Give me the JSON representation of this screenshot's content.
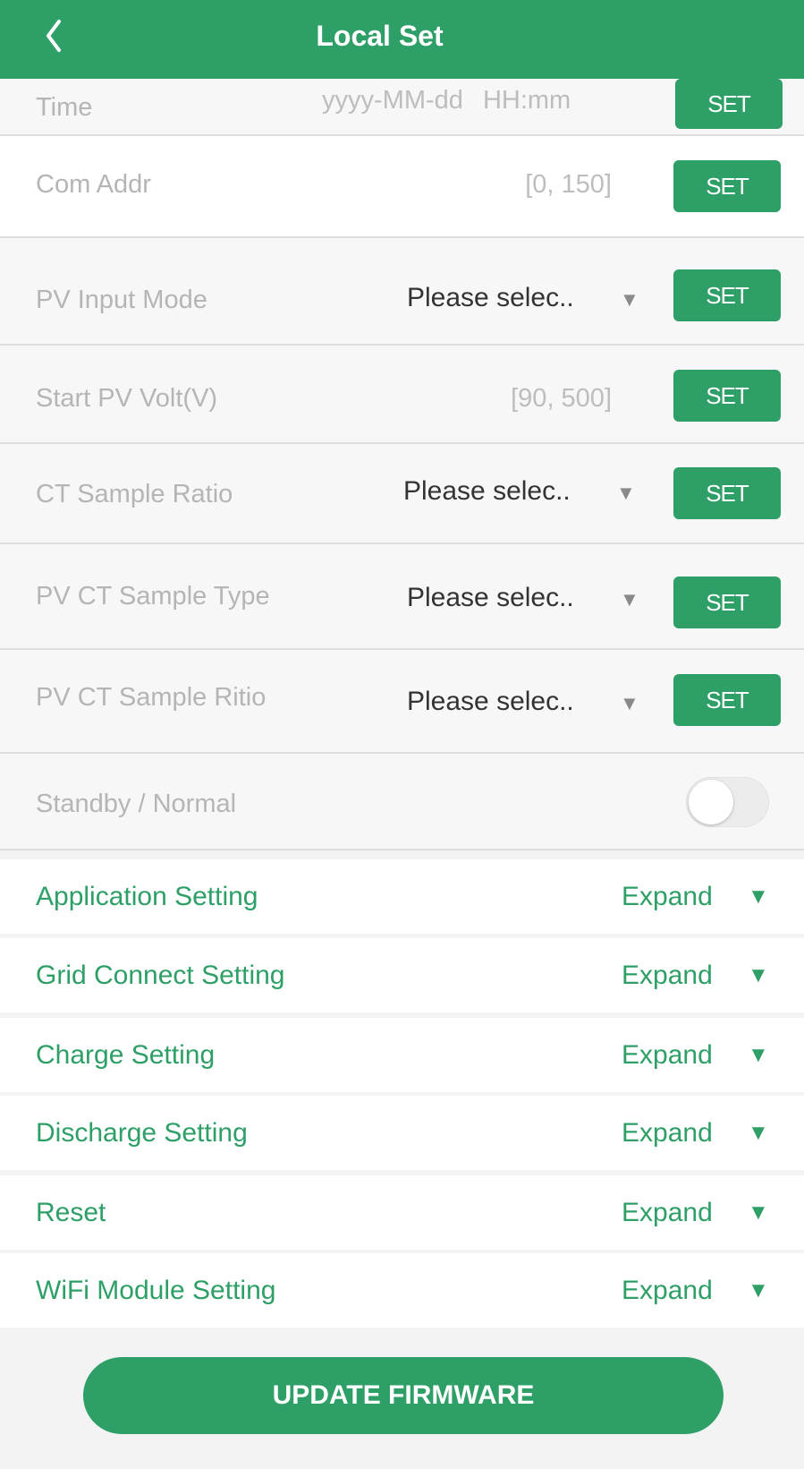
{
  "header": {
    "title": "Local Set",
    "back_icon": "chevron-left-icon"
  },
  "settings": {
    "time": {
      "label": "Time",
      "value": "yyyy-MM-dd  HH:mm",
      "button": "SET"
    },
    "com_addr": {
      "label": "Com Addr",
      "range": "[0, 150]",
      "button": "SET"
    },
    "pv_input_mode": {
      "label": "PV Input Mode",
      "selected": "Please selec..",
      "button": "SET"
    },
    "start_pv_volt": {
      "label": "Start PV Volt(V)",
      "range": "[90, 500]",
      "button": "SET"
    },
    "ct_sample_ratio": {
      "label": "CT Sample Ratio",
      "selected": "Please selec..",
      "button": "SET"
    },
    "pv_ct_sample_type": {
      "label": "PV CT Sample Type",
      "selected": "Please selec..",
      "button": "SET"
    },
    "pv_ct_sample_ritio": {
      "label": "PV CT Sample Ritio",
      "selected": "Please selec..",
      "button": "SET"
    },
    "standby": {
      "label": "Standby / Normal",
      "on": false
    }
  },
  "select_arrow": "▼",
  "sections": [
    {
      "label": "Application Setting",
      "action": "Expand"
    },
    {
      "label": "Grid Connect Setting",
      "action": "Expand"
    },
    {
      "label": "Charge Setting",
      "action": "Expand"
    },
    {
      "label": "Discharge Setting",
      "action": "Expand"
    },
    {
      "label": "Reset",
      "action": "Expand"
    },
    {
      "label": "WiFi Module Setting",
      "action": "Expand"
    }
  ],
  "expand_icon": "▼",
  "update_button": "UPDATE FIRMWARE",
  "colors": {
    "accent": "#2e9f66",
    "label_gray": "#b5b5b5",
    "background": "#f3f3f3"
  }
}
